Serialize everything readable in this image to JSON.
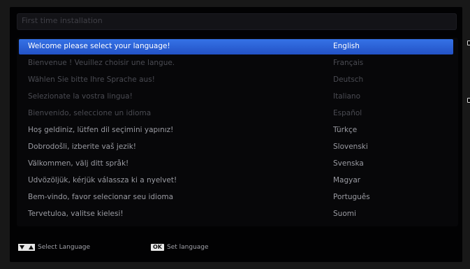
{
  "title": "First time installation",
  "languages": [
    {
      "greeting": "Welcome please select your language!",
      "language": "English",
      "state": "selected"
    },
    {
      "greeting": "Bienvenue ! Veuillez choisir une langue.",
      "language": "Français",
      "state": "dim"
    },
    {
      "greeting": "Wählen Sie bitte Ihre Sprache aus!",
      "language": "Deutsch",
      "state": "dim"
    },
    {
      "greeting": "Selezionate la vostra lingua!",
      "language": "Italiano",
      "state": "dim"
    },
    {
      "greeting": "Bienvenido, seleccione un idioma",
      "language": "Español",
      "state": "dim"
    },
    {
      "greeting": "Hoş geldiniz, lütfen dil seçimini yapınız!",
      "language": "Türkçe",
      "state": "normal"
    },
    {
      "greeting": "Dobrodošli, izberite vaš jezik!",
      "language": "Slovenski",
      "state": "normal"
    },
    {
      "greeting": "Välkommen, välj ditt språk!",
      "language": "Svenska",
      "state": "normal"
    },
    {
      "greeting": "Üdvözöljük, kérjük válassza ki a nyelvet!",
      "language": "Magyar",
      "state": "normal"
    },
    {
      "greeting": "Bem-vindo, favor selecionar seu idioma",
      "language": "Português",
      "state": "normal"
    },
    {
      "greeting": "Tervetuloa, valitse kielesi!",
      "language": "Suomi",
      "state": "normal"
    }
  ],
  "footer": {
    "select_label": "Select Language",
    "ok_key": "OK",
    "set_label": "Set language"
  },
  "colors": {
    "highlight": "#2a5fd4",
    "background": "#020203",
    "text": "#9a9ba2",
    "text_selected": "#ffffff"
  }
}
